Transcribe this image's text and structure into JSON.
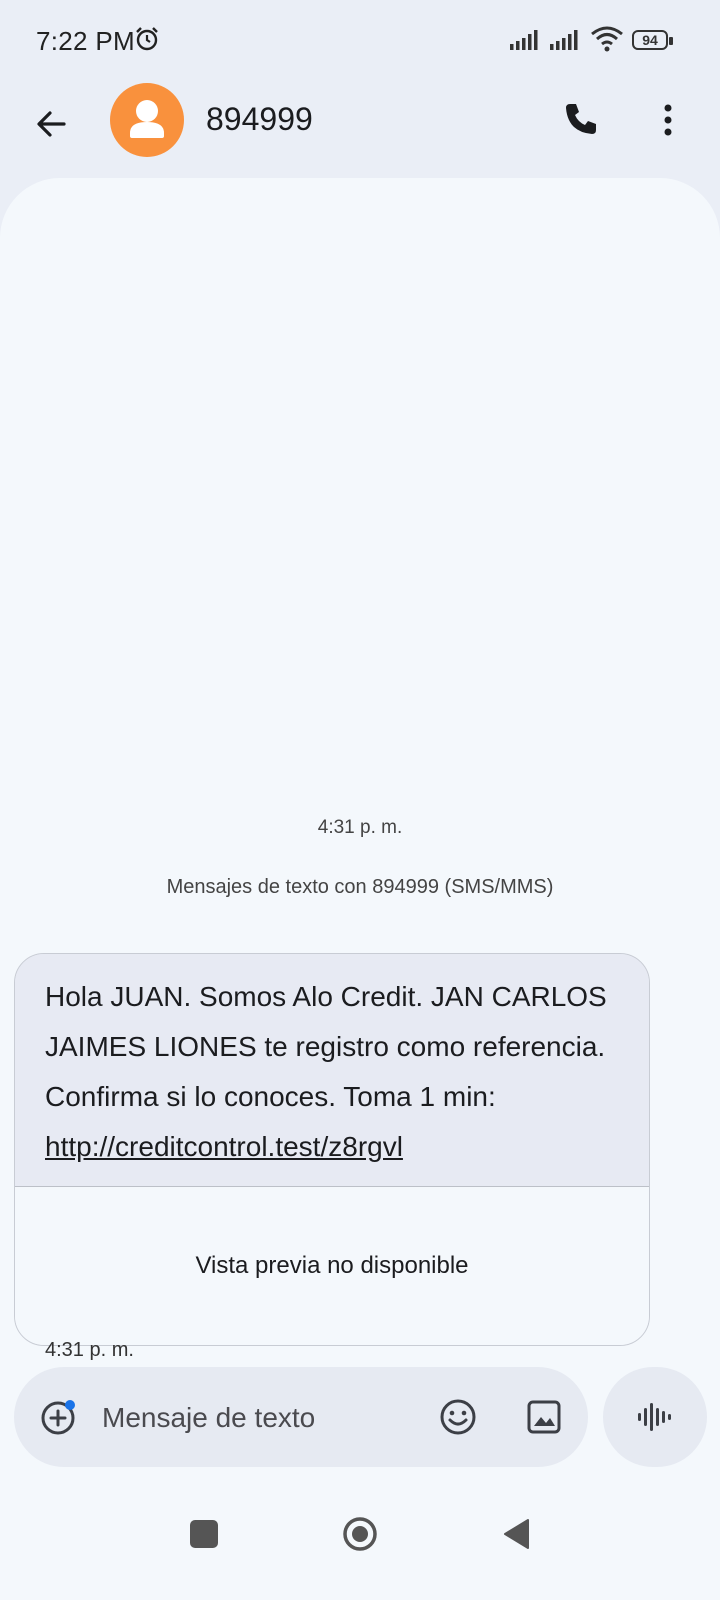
{
  "status_bar": {
    "time": "7:22 PM",
    "battery": "94"
  },
  "header": {
    "contact": "894999",
    "avatar_color": "#f9913d"
  },
  "conversation": {
    "date_label": "4:31 p. m.",
    "thread_info": "Mensajes de texto con 894999 (SMS/MMS)",
    "messages": [
      {
        "text": "Hola JUAN. Somos Alo Credit. JAN CARLOS JAIMES LIONES  te registro como referencia. Confirma si lo conoces. Toma 1 min: ",
        "link": "http://creditcontrol.test/z8rgvl",
        "preview": "Vista previa no disponible",
        "time": "4:31 p. m."
      }
    ]
  },
  "composer": {
    "placeholder": "Mensaje de texto"
  },
  "icons": {
    "back": "arrow-left-icon",
    "call": "phone-icon",
    "more": "more-vert-icon",
    "attach": "add-circle-icon",
    "emoji": "emoji-icon",
    "image": "image-icon",
    "voice": "waveform-icon"
  }
}
